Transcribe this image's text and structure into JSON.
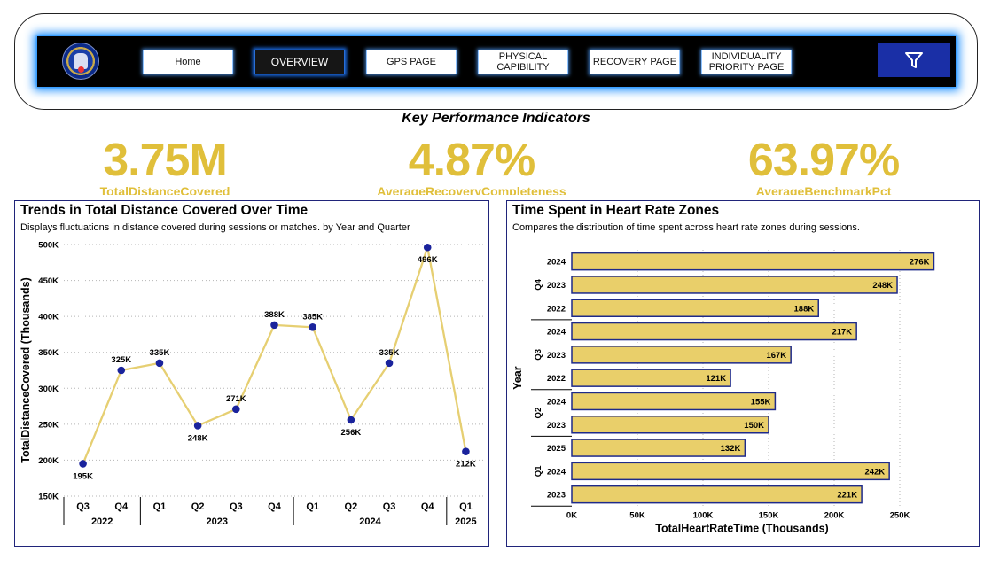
{
  "nav": {
    "logo_icon": "club-crest-icon",
    "buttons": [
      {
        "label": "Home",
        "active": false
      },
      {
        "label": "OVERVIEW",
        "active": true
      },
      {
        "label": "GPS PAGE",
        "active": false
      },
      {
        "label": "PHYSICAL\nCAPIBILITY",
        "active": false
      },
      {
        "label": "RECOVERY PAGE",
        "active": false
      },
      {
        "label": "INDIVIDUALITY\nPRIORITY PAGE",
        "active": false
      }
    ],
    "filter_icon": "filter-funnel-icon"
  },
  "kpi_section": {
    "title": "Key Performance Indicators",
    "cards": [
      {
        "value": "3.75M",
        "label": "TotalDistanceCovered"
      },
      {
        "value": "4.87%",
        "label": "AverageRecoveryCompleteness"
      },
      {
        "value": "63.97%",
        "label": "AverageBenchmarkPct"
      }
    ]
  },
  "colors": {
    "accent_gold": "#e0bf3a",
    "nav_glow": "#1e90ff",
    "point_blue": "#1a239c",
    "bar_fill": "#e9cf6a",
    "bar_border": "#1e2a8a"
  },
  "line_panel": {
    "title": "Trends in Total Distance Covered Over Time",
    "subtitle": "Displays fluctuations in distance covered during sessions or matches. by Year and Quarter"
  },
  "bar_panel": {
    "title": "Time Spent in Heart Rate Zones",
    "subtitle": "Compares the distribution of time spent across heart rate zones during sessions."
  },
  "chart_data": [
    {
      "type": "line",
      "ylabel": "TotalDistanceCovered (Thousands)",
      "ylim": [
        150,
        500
      ],
      "yticks": [
        "150K",
        "200K",
        "250K",
        "300K",
        "350K",
        "400K",
        "450K",
        "500K"
      ],
      "x_quarters": [
        "Q3",
        "Q4",
        "Q1",
        "Q2",
        "Q3",
        "Q4",
        "Q1",
        "Q2",
        "Q3",
        "Q4",
        "Q1"
      ],
      "x_years": [
        {
          "label": "2022",
          "span": 2
        },
        {
          "label": "2023",
          "span": 4
        },
        {
          "label": "2024",
          "span": 4
        },
        {
          "label": "2025",
          "span": 1
        }
      ],
      "values": [
        195,
        325,
        335,
        248,
        271,
        388,
        385,
        256,
        335,
        496,
        212
      ],
      "data_labels": [
        "195K",
        "325K",
        "335K",
        "248K",
        "271K",
        "388K",
        "385K",
        "256K",
        "335K",
        "496K",
        "212K"
      ],
      "grid": true
    },
    {
      "type": "bar",
      "orientation": "horizontal",
      "xlabel": "TotalHeartRateTime (Thousands)",
      "ylabel": "Year",
      "xlim": [
        0,
        250
      ],
      "xticks": [
        "0K",
        "50K",
        "100K",
        "150K",
        "200K",
        "250K"
      ],
      "groups": [
        {
          "label": "Q4",
          "years": [
            "2024",
            "2023",
            "2022"
          ],
          "values": [
            276,
            248,
            188
          ],
          "data_labels": [
            "276K",
            "248K",
            "188K"
          ]
        },
        {
          "label": "Q3",
          "years": [
            "2024",
            "2023",
            "2022"
          ],
          "values": [
            217,
            167,
            121
          ],
          "data_labels": [
            "217K",
            "167K",
            "121K"
          ]
        },
        {
          "label": "Q2",
          "years": [
            "2024",
            "2023"
          ],
          "values": [
            155,
            150
          ],
          "data_labels": [
            "155K",
            "150K"
          ]
        },
        {
          "label": "Q1",
          "years": [
            "2025",
            "2024",
            "2023"
          ],
          "values": [
            132,
            242,
            221
          ],
          "data_labels": [
            "132K",
            "242K",
            "221K"
          ]
        }
      ],
      "grid": true
    }
  ]
}
